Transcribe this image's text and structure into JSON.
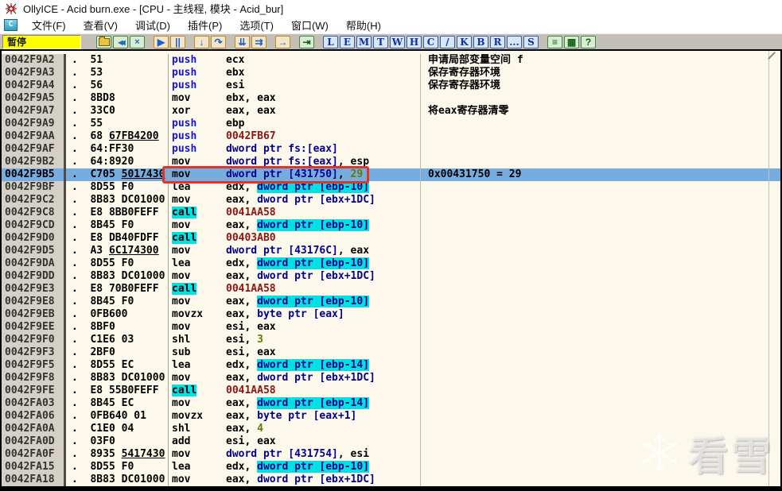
{
  "window": {
    "title": "OllyICE - Acid burn.exe - [CPU - 主线程, 模块 - Acid_bur]",
    "app_icon": "ollyice-bug-icon",
    "sysmenu_icon_letter": "C"
  },
  "menu": {
    "items": [
      {
        "name": "file",
        "label": "文件(F)"
      },
      {
        "name": "view",
        "label": "查看(V)"
      },
      {
        "name": "debug",
        "label": "调试(D)"
      },
      {
        "name": "plugins",
        "label": "插件(P)"
      },
      {
        "name": "options",
        "label": "选项(T)"
      },
      {
        "name": "window",
        "label": "窗口(W)"
      },
      {
        "name": "help",
        "label": "帮助(H)"
      }
    ]
  },
  "toolbar": {
    "status": "暂停",
    "buttons": [
      {
        "name": "open-file-button",
        "icon": "open-folder-icon",
        "glyph": "",
        "kind": "folder",
        "style": "g-file",
        "gap_before": true
      },
      {
        "name": "restart-button",
        "icon": "restart-icon",
        "glyph": "◀◀",
        "kind": "glyph",
        "style": "g-file",
        "gap_before": false
      },
      {
        "name": "close-program-button",
        "icon": "close-icon",
        "glyph": "×",
        "kind": "glyph",
        "style": "g-file",
        "gap_before": false
      },
      {
        "name": "run-button",
        "icon": "play-icon",
        "glyph": "▶",
        "kind": "glyph",
        "style": "g-run",
        "gap_before": true
      },
      {
        "name": "pause-button",
        "icon": "pause-icon",
        "glyph": "||",
        "kind": "glyph",
        "style": "g-run",
        "gap_before": false
      },
      {
        "name": "step-into-button",
        "icon": "step-into-icon",
        "glyph": "↓",
        "kind": "glyph",
        "style": "g-step",
        "gap_before": true
      },
      {
        "name": "step-over-button",
        "icon": "step-over-icon",
        "glyph": "↷",
        "kind": "glyph",
        "style": "g-step",
        "gap_before": false
      },
      {
        "name": "animate-into-button",
        "icon": "animate-into-icon",
        "glyph": "⇊",
        "kind": "glyph",
        "style": "g-step",
        "gap_before": true
      },
      {
        "name": "animate-over-button",
        "icon": "animate-over-icon",
        "glyph": "⇉",
        "kind": "glyph",
        "style": "g-step",
        "gap_before": false
      },
      {
        "name": "run-to-cursor-button",
        "icon": "run-to-arrow-icon",
        "glyph": "→",
        "kind": "glyph",
        "style": "g-step",
        "gap_before": true
      },
      {
        "name": "execute-till-return-button",
        "icon": "till-return-icon",
        "glyph": "⇥",
        "kind": "glyph",
        "style": "g-misc",
        "gap_before": true
      },
      {
        "name": "view-log-button",
        "icon": "letter-L-icon",
        "glyph": "L",
        "kind": "glyph",
        "style": "g-letter",
        "gap_before": true
      },
      {
        "name": "view-executables-button",
        "icon": "letter-E-icon",
        "glyph": "E",
        "kind": "glyph",
        "style": "g-letter",
        "gap_before": false
      },
      {
        "name": "view-memory-button",
        "icon": "letter-M-icon",
        "glyph": "M",
        "kind": "glyph",
        "style": "g-letter",
        "gap_before": false
      },
      {
        "name": "view-threads-button",
        "icon": "letter-T-icon",
        "glyph": "T",
        "kind": "glyph",
        "style": "g-letter",
        "gap_before": false
      },
      {
        "name": "view-windows-button",
        "icon": "letter-W-icon",
        "glyph": "W",
        "kind": "glyph",
        "style": "g-letter",
        "gap_before": false
      },
      {
        "name": "view-handles-button",
        "icon": "letter-H-icon",
        "glyph": "H",
        "kind": "glyph",
        "style": "g-letter",
        "gap_before": false
      },
      {
        "name": "view-cpu-button",
        "icon": "letter-C-icon",
        "glyph": "C",
        "kind": "glyph",
        "style": "g-letter",
        "gap_before": false
      },
      {
        "name": "view-patches-button",
        "icon": "slash-icon",
        "glyph": "/",
        "kind": "glyph",
        "style": "g-letter",
        "gap_before": false
      },
      {
        "name": "view-call-stack-button",
        "icon": "letter-K-icon",
        "glyph": "K",
        "kind": "glyph",
        "style": "g-letter",
        "gap_before": false
      },
      {
        "name": "view-breakpoints-button",
        "icon": "letter-B-icon",
        "glyph": "B",
        "kind": "glyph",
        "style": "g-letter",
        "gap_before": false
      },
      {
        "name": "view-references-button",
        "icon": "letter-R-icon",
        "glyph": "R",
        "kind": "glyph",
        "style": "g-letter",
        "gap_before": false
      },
      {
        "name": "view-more-button",
        "icon": "ellipsis-icon",
        "glyph": "...",
        "kind": "glyph",
        "style": "g-letter",
        "gap_before": false
      },
      {
        "name": "view-source-button",
        "icon": "letter-S-icon",
        "glyph": "S",
        "kind": "glyph",
        "style": "g-letter",
        "gap_before": false
      },
      {
        "name": "breakpoint-list-button",
        "icon": "list-icon",
        "glyph": "≡",
        "kind": "glyph",
        "style": "g-misc",
        "gap_before": true
      },
      {
        "name": "appearance-button",
        "icon": "palette-grid-icon",
        "glyph": "▦",
        "kind": "glyph",
        "style": "g-misc",
        "gap_before": false
      },
      {
        "name": "help-button",
        "icon": "question-icon",
        "glyph": "?",
        "kind": "glyph",
        "style": "g-misc",
        "gap_before": false
      }
    ]
  },
  "disasm": {
    "rows": [
      {
        "addr": "0042F9A2",
        "dot": ".",
        "hex": [
          [
            "51",
            0
          ]
        ],
        "mn": "push",
        "ms": "push",
        "ops": [
          [
            "ecx",
            "plain"
          ]
        ],
        "comment": "申请局部变量空间 f",
        "sel": false
      },
      {
        "addr": "0042F9A3",
        "dot": ".",
        "hex": [
          [
            "53",
            0
          ]
        ],
        "mn": "push",
        "ms": "push",
        "ops": [
          [
            "ebx",
            "plain"
          ]
        ],
        "comment": "保存寄存器环境",
        "sel": false
      },
      {
        "addr": "0042F9A4",
        "dot": ".",
        "hex": [
          [
            "56",
            0
          ]
        ],
        "mn": "push",
        "ms": "push",
        "ops": [
          [
            "esi",
            "plain"
          ]
        ],
        "comment": "保存寄存器环境",
        "sel": false
      },
      {
        "addr": "0042F9A5",
        "dot": ".",
        "hex": [
          [
            "8BD8",
            0
          ]
        ],
        "mn": "mov",
        "ms": "plain",
        "ops": [
          [
            "ebx, eax",
            "plain"
          ]
        ],
        "comment": "",
        "sel": false
      },
      {
        "addr": "0042F9A7",
        "dot": ".",
        "hex": [
          [
            "33C0",
            0
          ]
        ],
        "mn": "xor",
        "ms": "plain",
        "ops": [
          [
            "eax, eax",
            "plain"
          ]
        ],
        "comment": "将eax寄存器清零",
        "sel": false
      },
      {
        "addr": "0042F9A9",
        "dot": ".",
        "hex": [
          [
            "55",
            0
          ]
        ],
        "mn": "push",
        "ms": "push",
        "ops": [
          [
            "ebp",
            "plain"
          ]
        ],
        "comment": "",
        "sel": false
      },
      {
        "addr": "0042F9AA",
        "dot": ".",
        "hex": [
          [
            "68 ",
            0
          ],
          [
            "67FB4200",
            1
          ]
        ],
        "mn": "push",
        "ms": "push",
        "ops": [
          [
            "0042FB67",
            "addr"
          ]
        ],
        "comment": "",
        "sel": false
      },
      {
        "addr": "0042F9AF",
        "dot": ".",
        "hex": [
          [
            "64:FF30",
            0
          ]
        ],
        "mn": "push",
        "ms": "push",
        "ops": [
          [
            "dword ptr fs:[eax]",
            "mem"
          ]
        ],
        "comment": "",
        "sel": false
      },
      {
        "addr": "0042F9B2",
        "dot": ".",
        "hex": [
          [
            "64:8920",
            0
          ]
        ],
        "mn": "mov",
        "ms": "plain",
        "ops": [
          [
            "dword ptr fs:[eax]",
            "mem"
          ],
          [
            ", esp",
            "plain"
          ]
        ],
        "comment": "",
        "sel": false
      },
      {
        "addr": "0042F9B5",
        "dot": ".",
        "hex": [
          [
            "C705 ",
            0
          ],
          [
            "5017430",
            1
          ]
        ],
        "mn": "mov",
        "ms": "plain",
        "ops": [
          [
            "dword ptr [431750]",
            "mem"
          ],
          [
            ", ",
            "plain"
          ],
          [
            "29",
            "imm"
          ]
        ],
        "comment": "0x00431750 = 29",
        "sel": true
      },
      {
        "addr": "0042F9BF",
        "dot": ".",
        "hex": [
          [
            "8D55 F0",
            0
          ]
        ],
        "mn": "lea",
        "ms": "plain",
        "ops": [
          [
            "edx, ",
            "plain"
          ],
          [
            "dword ptr [ebp-10]",
            "stk"
          ]
        ],
        "comment": "",
        "sel": false
      },
      {
        "addr": "0042F9C2",
        "dot": ".",
        "hex": [
          [
            "8B83 DC01000",
            0
          ]
        ],
        "mn": "mov",
        "ms": "plain",
        "ops": [
          [
            "eax, ",
            "plain"
          ],
          [
            "dword ptr [ebx+1DC]",
            "mem"
          ]
        ],
        "comment": "",
        "sel": false
      },
      {
        "addr": "0042F9C8",
        "dot": ".",
        "hex": [
          [
            "E8 8BB0FEFF",
            0
          ]
        ],
        "mn": "call",
        "ms": "call",
        "ops": [
          [
            "0041AA58",
            "addr"
          ]
        ],
        "comment": "",
        "sel": false
      },
      {
        "addr": "0042F9CD",
        "dot": ".",
        "hex": [
          [
            "8B45 F0",
            0
          ]
        ],
        "mn": "mov",
        "ms": "plain",
        "ops": [
          [
            "eax, ",
            "plain"
          ],
          [
            "dword ptr [ebp-10]",
            "stk"
          ]
        ],
        "comment": "",
        "sel": false
      },
      {
        "addr": "0042F9D0",
        "dot": ".",
        "hex": [
          [
            "E8 DB40FDFF",
            0
          ]
        ],
        "mn": "call",
        "ms": "call",
        "ops": [
          [
            "00403AB0",
            "addr"
          ]
        ],
        "comment": "",
        "sel": false
      },
      {
        "addr": "0042F9D5",
        "dot": ".",
        "hex": [
          [
            "A3 ",
            0
          ],
          [
            "6C174300",
            1
          ]
        ],
        "mn": "mov",
        "ms": "plain",
        "ops": [
          [
            "dword ptr [43176C]",
            "mem"
          ],
          [
            ", eax",
            "plain"
          ]
        ],
        "comment": "",
        "sel": false
      },
      {
        "addr": "0042F9DA",
        "dot": ".",
        "hex": [
          [
            "8D55 F0",
            0
          ]
        ],
        "mn": "lea",
        "ms": "plain",
        "ops": [
          [
            "edx, ",
            "plain"
          ],
          [
            "dword ptr [ebp-10]",
            "stk"
          ]
        ],
        "comment": "",
        "sel": false
      },
      {
        "addr": "0042F9DD",
        "dot": ".",
        "hex": [
          [
            "8B83 DC01000",
            0
          ]
        ],
        "mn": "mov",
        "ms": "plain",
        "ops": [
          [
            "eax, ",
            "plain"
          ],
          [
            "dword ptr [ebx+1DC]",
            "mem"
          ]
        ],
        "comment": "",
        "sel": false
      },
      {
        "addr": "0042F9E3",
        "dot": ".",
        "hex": [
          [
            "E8 70B0FEFF",
            0
          ]
        ],
        "mn": "call",
        "ms": "call",
        "ops": [
          [
            "0041AA58",
            "addr"
          ]
        ],
        "comment": "",
        "sel": false
      },
      {
        "addr": "0042F9E8",
        "dot": ".",
        "hex": [
          [
            "8B45 F0",
            0
          ]
        ],
        "mn": "mov",
        "ms": "plain",
        "ops": [
          [
            "eax, ",
            "plain"
          ],
          [
            "dword ptr [ebp-10]",
            "stk"
          ]
        ],
        "comment": "",
        "sel": false
      },
      {
        "addr": "0042F9EB",
        "dot": ".",
        "hex": [
          [
            "0FB600",
            0
          ]
        ],
        "mn": "movzx",
        "ms": "plain",
        "ops": [
          [
            "eax, ",
            "plain"
          ],
          [
            "byte ptr [eax]",
            "mem"
          ]
        ],
        "comment": "",
        "sel": false
      },
      {
        "addr": "0042F9EE",
        "dot": ".",
        "hex": [
          [
            "8BF0",
            0
          ]
        ],
        "mn": "mov",
        "ms": "plain",
        "ops": [
          [
            "esi, eax",
            "plain"
          ]
        ],
        "comment": "",
        "sel": false
      },
      {
        "addr": "0042F9F0",
        "dot": ".",
        "hex": [
          [
            "C1E6 03",
            0
          ]
        ],
        "mn": "shl",
        "ms": "plain",
        "ops": [
          [
            "esi, ",
            "plain"
          ],
          [
            "3",
            "imm"
          ]
        ],
        "comment": "",
        "sel": false
      },
      {
        "addr": "0042F9F3",
        "dot": ".",
        "hex": [
          [
            "2BF0",
            0
          ]
        ],
        "mn": "sub",
        "ms": "plain",
        "ops": [
          [
            "esi, eax",
            "plain"
          ]
        ],
        "comment": "",
        "sel": false
      },
      {
        "addr": "0042F9F5",
        "dot": ".",
        "hex": [
          [
            "8D55 EC",
            0
          ]
        ],
        "mn": "lea",
        "ms": "plain",
        "ops": [
          [
            "edx, ",
            "plain"
          ],
          [
            "dword ptr [ebp-14]",
            "stk"
          ]
        ],
        "comment": "",
        "sel": false
      },
      {
        "addr": "0042F9F8",
        "dot": ".",
        "hex": [
          [
            "8B83 DC01000",
            0
          ]
        ],
        "mn": "mov",
        "ms": "plain",
        "ops": [
          [
            "eax, ",
            "plain"
          ],
          [
            "dword ptr [ebx+1DC]",
            "mem"
          ]
        ],
        "comment": "",
        "sel": false
      },
      {
        "addr": "0042F9FE",
        "dot": ".",
        "hex": [
          [
            "E8 55B0FEFF",
            0
          ]
        ],
        "mn": "call",
        "ms": "call",
        "ops": [
          [
            "0041AA58",
            "addr"
          ]
        ],
        "comment": "",
        "sel": false
      },
      {
        "addr": "0042FA03",
        "dot": ".",
        "hex": [
          [
            "8B45 EC",
            0
          ]
        ],
        "mn": "mov",
        "ms": "plain",
        "ops": [
          [
            "eax, ",
            "plain"
          ],
          [
            "dword ptr [ebp-14]",
            "stk"
          ]
        ],
        "comment": "",
        "sel": false
      },
      {
        "addr": "0042FA06",
        "dot": ".",
        "hex": [
          [
            "0FB640 01",
            0
          ]
        ],
        "mn": "movzx",
        "ms": "plain",
        "ops": [
          [
            "eax, ",
            "plain"
          ],
          [
            "byte ptr [eax+1]",
            "mem"
          ]
        ],
        "comment": "",
        "sel": false
      },
      {
        "addr": "0042FA0A",
        "dot": ".",
        "hex": [
          [
            "C1E0 04",
            0
          ]
        ],
        "mn": "shl",
        "ms": "plain",
        "ops": [
          [
            "eax, ",
            "plain"
          ],
          [
            "4",
            "imm"
          ]
        ],
        "comment": "",
        "sel": false
      },
      {
        "addr": "0042FA0D",
        "dot": ".",
        "hex": [
          [
            "03F0",
            0
          ]
        ],
        "mn": "add",
        "ms": "plain",
        "ops": [
          [
            "esi, eax",
            "plain"
          ]
        ],
        "comment": "",
        "sel": false
      },
      {
        "addr": "0042FA0F",
        "dot": ".",
        "hex": [
          [
            "8935 ",
            0
          ],
          [
            "5417430",
            1
          ]
        ],
        "mn": "mov",
        "ms": "plain",
        "ops": [
          [
            "dword ptr [431754]",
            "mem"
          ],
          [
            ", esi",
            "plain"
          ]
        ],
        "comment": "",
        "sel": false
      },
      {
        "addr": "0042FA15",
        "dot": ".",
        "hex": [
          [
            "8D55 F0",
            0
          ]
        ],
        "mn": "lea",
        "ms": "plain",
        "ops": [
          [
            "edx, ",
            "plain"
          ],
          [
            "dword ptr [ebp-10]",
            "stk"
          ]
        ],
        "comment": "",
        "sel": false
      },
      {
        "addr": "0042FA18",
        "dot": ".",
        "hex": [
          [
            "8B83 DC01000",
            0
          ]
        ],
        "mn": "mov",
        "ms": "plain",
        "ops": [
          [
            "eax, ",
            "plain"
          ],
          [
            "dword ptr [ebx+1DC]",
            "mem"
          ]
        ],
        "comment": "",
        "sel": false
      }
    ]
  },
  "annotation": {
    "type": "red-highlight-box",
    "around": "mov dword ptr [431750], 29"
  },
  "watermark": {
    "text": "看雪",
    "icon": "snowflake-icon"
  },
  "colors": {
    "selection_blue": "#79acde",
    "highlight_cyan": "#00e2e2",
    "mem_operand": "#00008e",
    "jump_target_red": "#8e1410",
    "immediate_olive": "#637c00",
    "push_blue": "#1414d8",
    "pane_background": "#fcf8ec",
    "address_gutter": "#d4d0c8",
    "status_yellow": "#ffff00",
    "annotation_red": "#e03428"
  }
}
